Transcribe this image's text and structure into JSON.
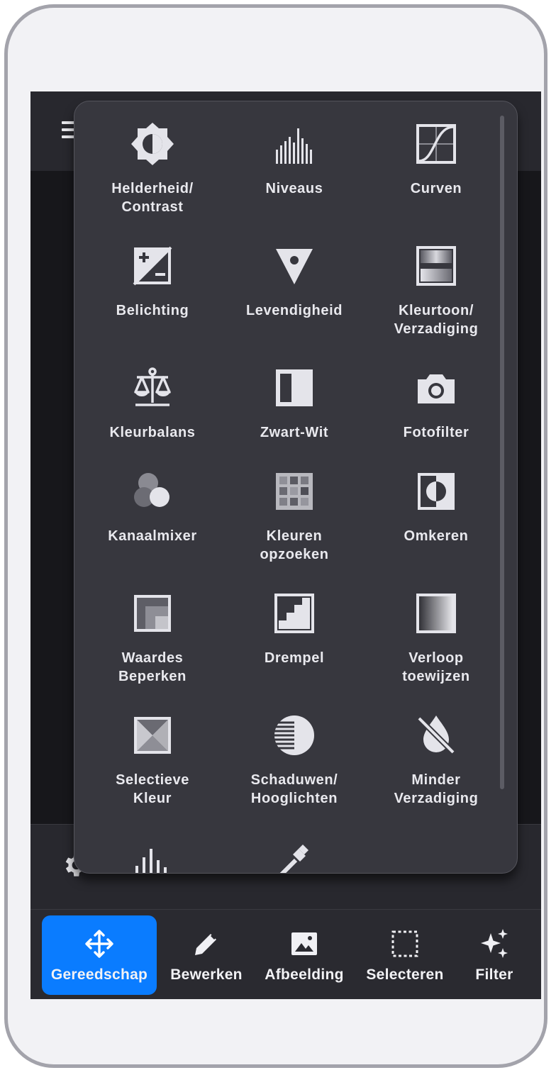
{
  "adjustments": [
    {
      "label": "Helderheid/\nContrast",
      "icon": "brightness-contrast-icon"
    },
    {
      "label": "Niveaus",
      "icon": "levels-icon"
    },
    {
      "label": "Curven",
      "icon": "curves-icon"
    },
    {
      "label": "Belichting",
      "icon": "exposure-icon"
    },
    {
      "label": "Levendigheid",
      "icon": "vibrance-icon"
    },
    {
      "label": "Kleurtoon/\nVerzadiging",
      "icon": "hue-saturation-icon"
    },
    {
      "label": "Kleurbalans",
      "icon": "color-balance-icon"
    },
    {
      "label": "Zwart-Wit",
      "icon": "black-white-icon"
    },
    {
      "label": "Fotofilter",
      "icon": "camera-icon"
    },
    {
      "label": "Kanaalmixer",
      "icon": "channel-mixer-icon"
    },
    {
      "label": "Kleuren\nopzoeken",
      "icon": "color-lookup-icon"
    },
    {
      "label": "Omkeren",
      "icon": "invert-icon"
    },
    {
      "label": "Waardes\nBeperken",
      "icon": "posterize-icon"
    },
    {
      "label": "Drempel",
      "icon": "threshold-icon"
    },
    {
      "label": "Verloop\ntoewijzen",
      "icon": "gradient-map-icon"
    },
    {
      "label": "Selectieve\nKleur",
      "icon": "selective-color-icon"
    },
    {
      "label": "Schaduwen/\nHooglichten",
      "icon": "shadows-highlights-icon"
    },
    {
      "label": "Minder\nVerzadiging",
      "icon": "desaturate-icon"
    }
  ],
  "partial_icons": [
    "histogram-icon",
    "eyedropper-icon"
  ],
  "bottom_tabs": [
    {
      "label": "Gereedschap",
      "icon": "move-icon",
      "active": true
    },
    {
      "label": "Bewerken",
      "icon": "pencil-icon",
      "active": false
    },
    {
      "label": "Afbeelding",
      "icon": "image-icon",
      "active": false
    },
    {
      "label": "Selecteren",
      "icon": "selection-icon",
      "active": false
    },
    {
      "label": "Filter",
      "icon": "sparkle-icon",
      "active": false
    }
  ],
  "colors": {
    "accent": "#0a7cff",
    "panel": "#37373e",
    "icon": "#e4e4ea"
  }
}
